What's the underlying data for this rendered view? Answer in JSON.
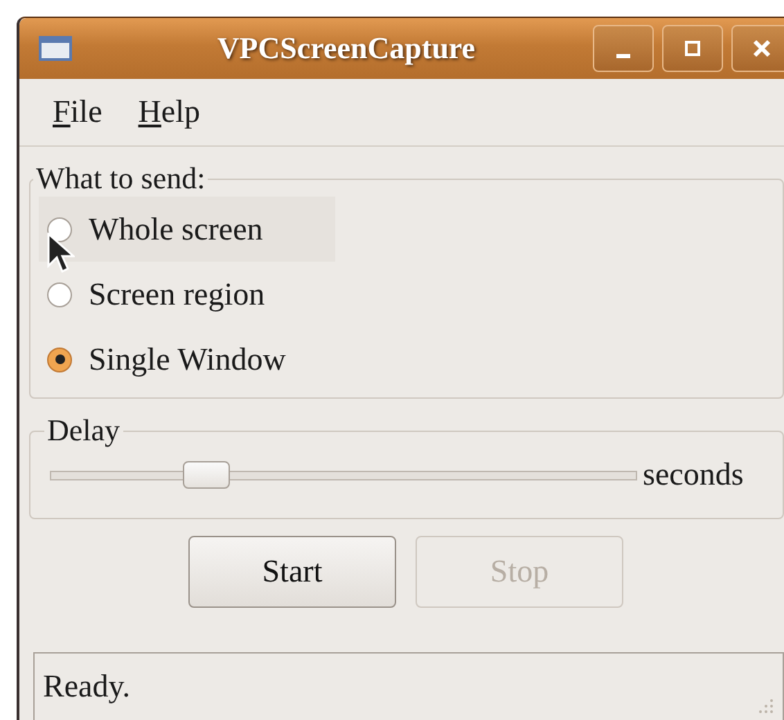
{
  "window": {
    "title": "VPCScreenCapture"
  },
  "menu": [
    {
      "label": "File"
    },
    {
      "label": "Help"
    }
  ],
  "send_group": {
    "title": "What to send:",
    "options": [
      {
        "label": "Whole screen",
        "selected": false,
        "hovered": true
      },
      {
        "label": "Screen region",
        "selected": false,
        "hovered": false
      },
      {
        "label": "Single Window",
        "selected": true,
        "hovered": false
      }
    ]
  },
  "delay_group": {
    "title": "Delay",
    "slider": {
      "level": 0.27
    },
    "unit": "seconds"
  },
  "buttons": [
    {
      "label": "Start",
      "disabled": false
    },
    {
      "label": "Stop",
      "disabled": true
    }
  ],
  "status_bar": {
    "text": "Ready."
  }
}
